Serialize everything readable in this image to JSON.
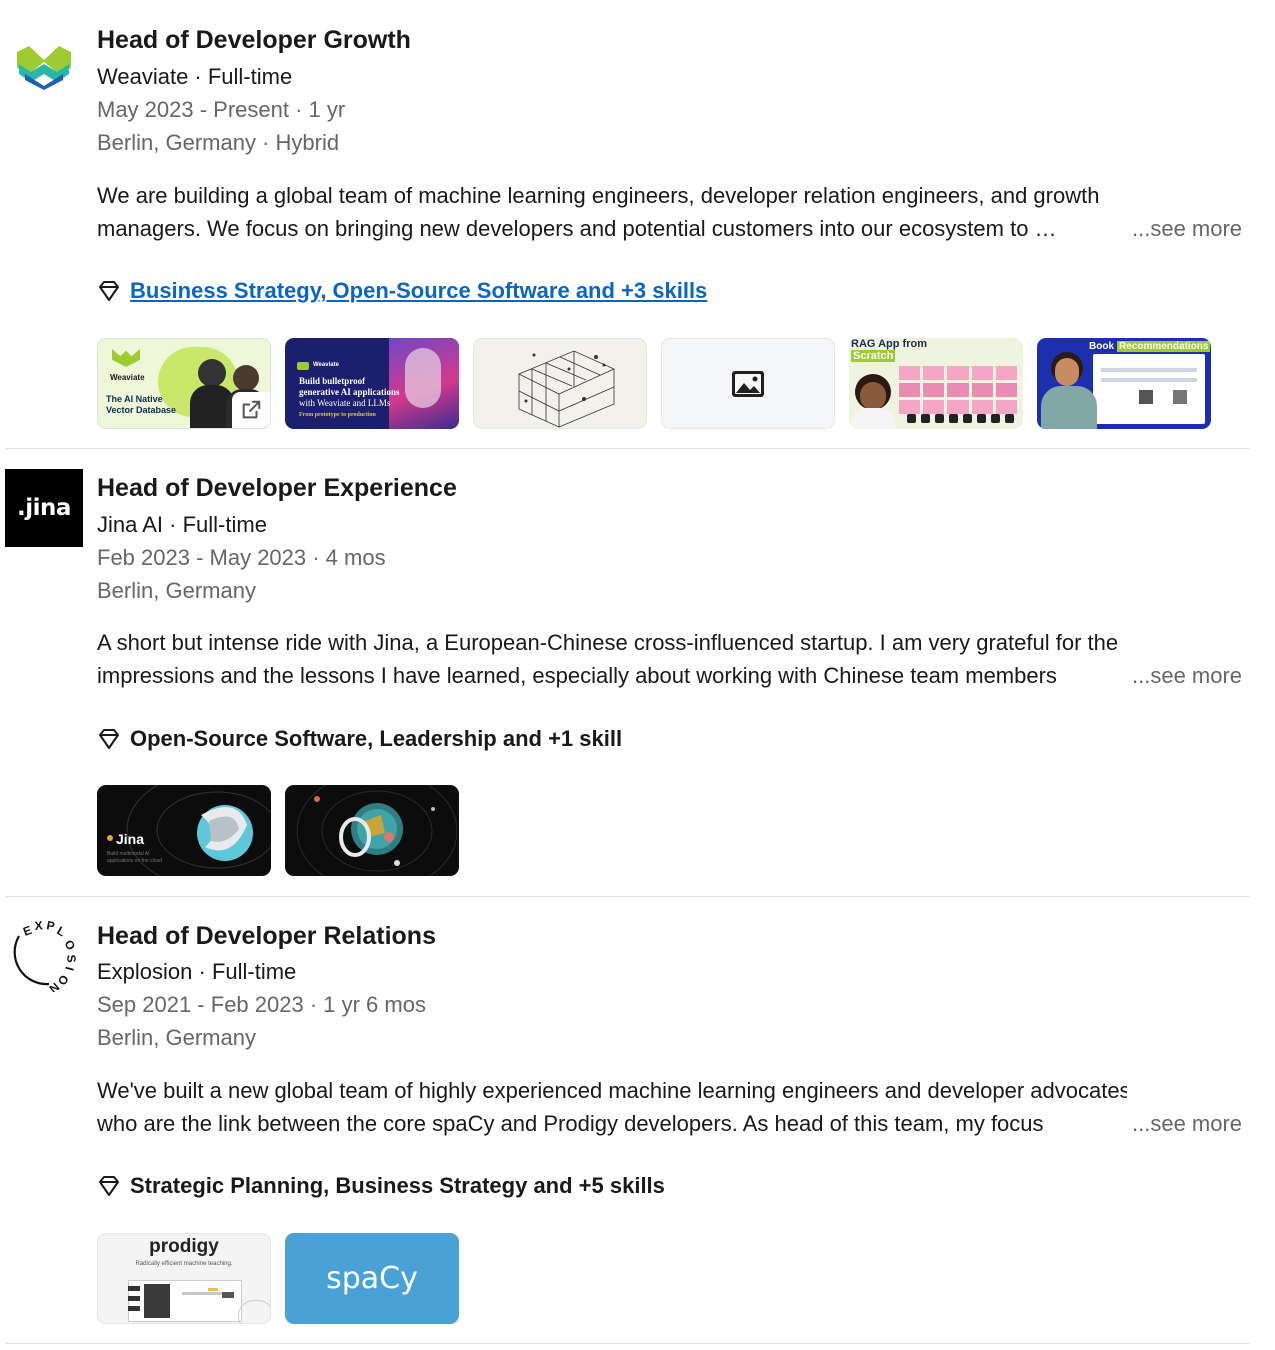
{
  "experiences": [
    {
      "title": "Head of Developer Growth",
      "company_line": "Weaviate · Full-time",
      "dates": "May 2023 - Present · 1 yr",
      "location": "Berlin, Germany · Hybrid",
      "description_line1": "We are building a global team of machine learning engineers, developer relation engineers, and growth",
      "description_line2": "managers. We focus on bringing new developers and potential customers into our ecosystem to …",
      "see_more": "...see more",
      "skills": "Business Strategy, Open-Source Software and +3 skills",
      "media": {
        "thumb1": {
          "brand": "Weaviate",
          "caption_line1": "The AI Native",
          "caption_line2": "Vector Database"
        },
        "thumb2": {
          "brand": "Weaviate",
          "caption_line1": "Build bulletproof",
          "caption_line2": "generative AI applications",
          "caption_line3": "with Weaviate and LLMs",
          "caption_line4": "From prototype to production"
        },
        "thumb5": {
          "title_line1": "RAG App from",
          "title_line2": "Scratch"
        },
        "thumb6": {
          "title_a": "Book",
          "title_b": "Recommendations"
        }
      }
    },
    {
      "title": "Head of Developer Experience",
      "company_line": "Jina AI · Full-time",
      "dates": "Feb 2023 - May 2023 · 4 mos",
      "location": "Berlin, Germany",
      "logo_text": ".jina",
      "description_line1": "A short but intense ride with Jina, a European-Chinese cross-influenced startup. I am very grateful for the",
      "description_line2": "impressions and the lessons I have learned, especially about working with Chinese team members",
      "see_more": "...see more",
      "skills": "Open-Source Software, Leadership and +1 skill",
      "media": {
        "thumb1": {
          "brand": "Jina",
          "caption": "Build multimodal AI applications on the cloud"
        }
      }
    },
    {
      "title": "Head of Developer Relations",
      "company_line": "Explosion · Full-time",
      "dates": "Sep 2021 - Feb 2023 · 1 yr 6 mos",
      "location": "Berlin, Germany",
      "logo_text": "EXPLOSION",
      "description_line1": "We've built a new global team of highly experienced machine learning engineers and developer advocates",
      "description_line2": "who are the link between the core spaCy and Prodigy developers. As head of this team, my focus",
      "see_more": "...see more",
      "skills": "Strategic Planning, Business Strategy and +5 skills",
      "media": {
        "thumb1": {
          "title": "prodigy",
          "caption": "Radically efficient machine teaching."
        },
        "thumb2": {
          "title": "spaCy"
        }
      }
    }
  ],
  "icons": {
    "skills": "diamond-icon",
    "external_link": "external-link-icon",
    "image_placeholder": "image-icon"
  },
  "colors": {
    "link": "#0a66c2",
    "secondary_text": "#666666",
    "divider": "#e0e0e0"
  }
}
